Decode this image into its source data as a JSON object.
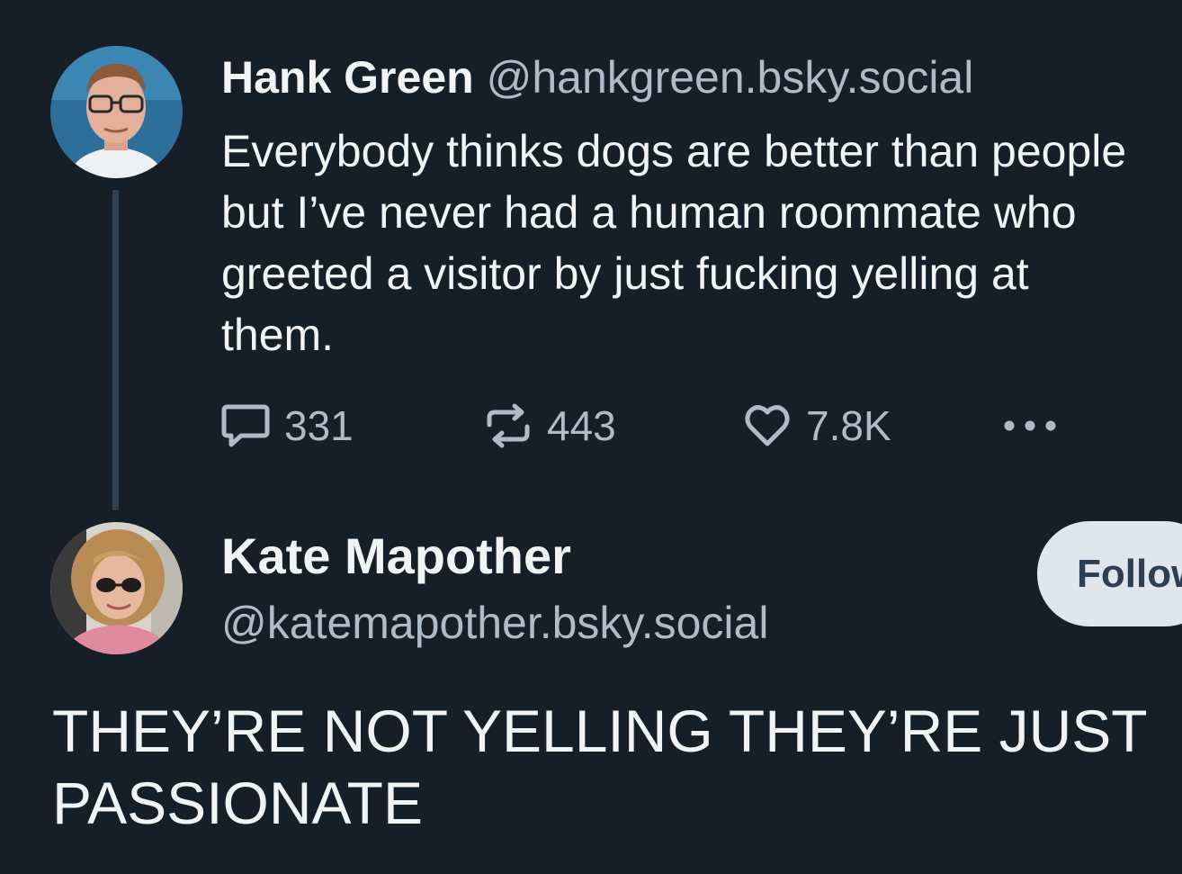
{
  "original_post": {
    "author": {
      "display_name": "Hank Green",
      "handle": "@hankgreen.bsky.social"
    },
    "text": "Everybody thinks dogs are better than people but I’ve never had a human roommate who greeted a visitor by just fucking yelling at them.",
    "actions": {
      "reply_icon": "speech-bubble-icon",
      "reply_count": "331",
      "repost_icon": "repost-arrows-icon",
      "repost_count": "443",
      "like_icon": "heart-icon",
      "like_count": "7.8K",
      "more_icon": "ellipsis-icon"
    }
  },
  "reply_post": {
    "author": {
      "display_name": "Kate Mapother",
      "handle": "@katemapother.bsky.social"
    },
    "follow_label": "Follow",
    "text": "THEY’RE NOT YELLING THEY’RE JUST PASSIONATE"
  },
  "colors": {
    "background": "#161e27",
    "primary_text": "#f1f3f5",
    "secondary_text": "#aebbc9",
    "thread_line": "#2e4052",
    "follow_button_bg": "#dfe6ee",
    "follow_button_text": "#2f3f52"
  }
}
